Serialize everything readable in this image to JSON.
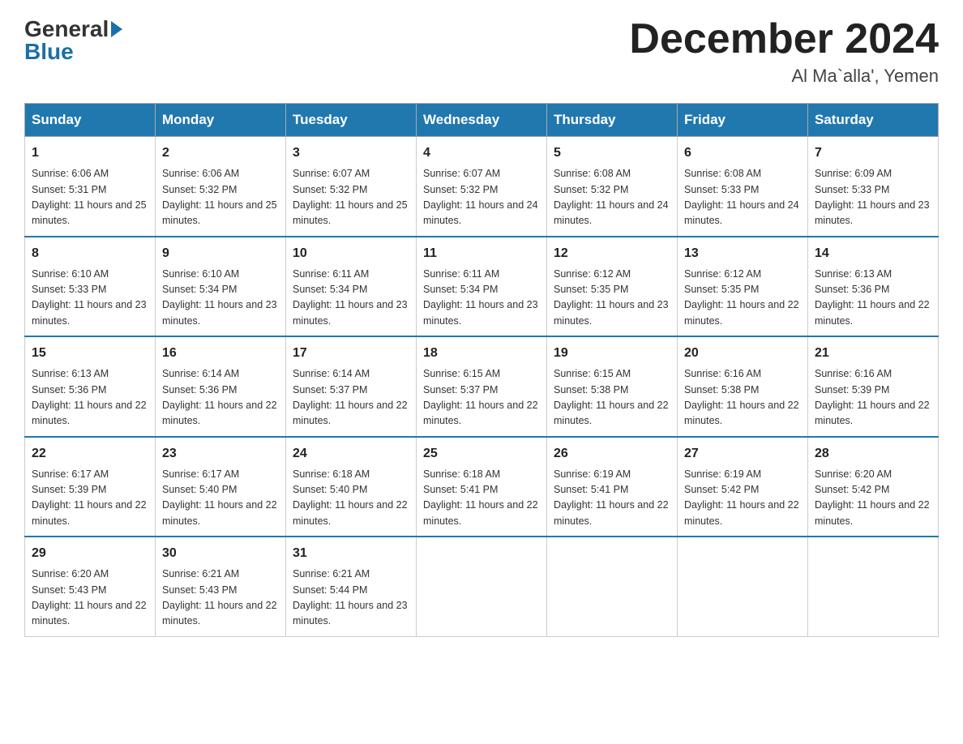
{
  "logo": {
    "general": "General",
    "blue": "Blue"
  },
  "title": {
    "month": "December 2024",
    "location": "Al Ma`alla', Yemen"
  },
  "days": {
    "headers": [
      "Sunday",
      "Monday",
      "Tuesday",
      "Wednesday",
      "Thursday",
      "Friday",
      "Saturday"
    ]
  },
  "weeks": [
    {
      "days": [
        {
          "num": "1",
          "sunrise": "6:06 AM",
          "sunset": "5:31 PM",
          "daylight": "11 hours and 25 minutes."
        },
        {
          "num": "2",
          "sunrise": "6:06 AM",
          "sunset": "5:32 PM",
          "daylight": "11 hours and 25 minutes."
        },
        {
          "num": "3",
          "sunrise": "6:07 AM",
          "sunset": "5:32 PM",
          "daylight": "11 hours and 25 minutes."
        },
        {
          "num": "4",
          "sunrise": "6:07 AM",
          "sunset": "5:32 PM",
          "daylight": "11 hours and 24 minutes."
        },
        {
          "num": "5",
          "sunrise": "6:08 AM",
          "sunset": "5:32 PM",
          "daylight": "11 hours and 24 minutes."
        },
        {
          "num": "6",
          "sunrise": "6:08 AM",
          "sunset": "5:33 PM",
          "daylight": "11 hours and 24 minutes."
        },
        {
          "num": "7",
          "sunrise": "6:09 AM",
          "sunset": "5:33 PM",
          "daylight": "11 hours and 23 minutes."
        }
      ]
    },
    {
      "days": [
        {
          "num": "8",
          "sunrise": "6:10 AM",
          "sunset": "5:33 PM",
          "daylight": "11 hours and 23 minutes."
        },
        {
          "num": "9",
          "sunrise": "6:10 AM",
          "sunset": "5:34 PM",
          "daylight": "11 hours and 23 minutes."
        },
        {
          "num": "10",
          "sunrise": "6:11 AM",
          "sunset": "5:34 PM",
          "daylight": "11 hours and 23 minutes."
        },
        {
          "num": "11",
          "sunrise": "6:11 AM",
          "sunset": "5:34 PM",
          "daylight": "11 hours and 23 minutes."
        },
        {
          "num": "12",
          "sunrise": "6:12 AM",
          "sunset": "5:35 PM",
          "daylight": "11 hours and 23 minutes."
        },
        {
          "num": "13",
          "sunrise": "6:12 AM",
          "sunset": "5:35 PM",
          "daylight": "11 hours and 22 minutes."
        },
        {
          "num": "14",
          "sunrise": "6:13 AM",
          "sunset": "5:36 PM",
          "daylight": "11 hours and 22 minutes."
        }
      ]
    },
    {
      "days": [
        {
          "num": "15",
          "sunrise": "6:13 AM",
          "sunset": "5:36 PM",
          "daylight": "11 hours and 22 minutes."
        },
        {
          "num": "16",
          "sunrise": "6:14 AM",
          "sunset": "5:36 PM",
          "daylight": "11 hours and 22 minutes."
        },
        {
          "num": "17",
          "sunrise": "6:14 AM",
          "sunset": "5:37 PM",
          "daylight": "11 hours and 22 minutes."
        },
        {
          "num": "18",
          "sunrise": "6:15 AM",
          "sunset": "5:37 PM",
          "daylight": "11 hours and 22 minutes."
        },
        {
          "num": "19",
          "sunrise": "6:15 AM",
          "sunset": "5:38 PM",
          "daylight": "11 hours and 22 minutes."
        },
        {
          "num": "20",
          "sunrise": "6:16 AM",
          "sunset": "5:38 PM",
          "daylight": "11 hours and 22 minutes."
        },
        {
          "num": "21",
          "sunrise": "6:16 AM",
          "sunset": "5:39 PM",
          "daylight": "11 hours and 22 minutes."
        }
      ]
    },
    {
      "days": [
        {
          "num": "22",
          "sunrise": "6:17 AM",
          "sunset": "5:39 PM",
          "daylight": "11 hours and 22 minutes."
        },
        {
          "num": "23",
          "sunrise": "6:17 AM",
          "sunset": "5:40 PM",
          "daylight": "11 hours and 22 minutes."
        },
        {
          "num": "24",
          "sunrise": "6:18 AM",
          "sunset": "5:40 PM",
          "daylight": "11 hours and 22 minutes."
        },
        {
          "num": "25",
          "sunrise": "6:18 AM",
          "sunset": "5:41 PM",
          "daylight": "11 hours and 22 minutes."
        },
        {
          "num": "26",
          "sunrise": "6:19 AM",
          "sunset": "5:41 PM",
          "daylight": "11 hours and 22 minutes."
        },
        {
          "num": "27",
          "sunrise": "6:19 AM",
          "sunset": "5:42 PM",
          "daylight": "11 hours and 22 minutes."
        },
        {
          "num": "28",
          "sunrise": "6:20 AM",
          "sunset": "5:42 PM",
          "daylight": "11 hours and 22 minutes."
        }
      ]
    },
    {
      "days": [
        {
          "num": "29",
          "sunrise": "6:20 AM",
          "sunset": "5:43 PM",
          "daylight": "11 hours and 22 minutes."
        },
        {
          "num": "30",
          "sunrise": "6:21 AM",
          "sunset": "5:43 PM",
          "daylight": "11 hours and 22 minutes."
        },
        {
          "num": "31",
          "sunrise": "6:21 AM",
          "sunset": "5:44 PM",
          "daylight": "11 hours and 23 minutes."
        },
        null,
        null,
        null,
        null
      ]
    }
  ]
}
